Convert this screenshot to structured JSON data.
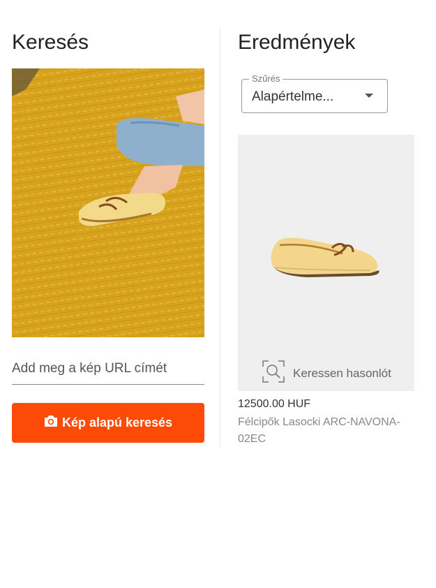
{
  "search": {
    "title": "Keresés",
    "url_placeholder": "Add meg a kép URL címét",
    "button_label": "Kép alapú keresés"
  },
  "results": {
    "title": "Eredmények",
    "filter": {
      "legend": "Szűrés",
      "value": "Alapértelme..."
    },
    "items": [
      {
        "find_similar": "Keressen hasonlót",
        "price": "12500.00 HUF",
        "name": "Félcipők Lasocki ARC-NAVONA-02EC"
      }
    ]
  },
  "colors": {
    "accent": "#fd4a07",
    "card_bg": "#efefef",
    "fabric": "#d9a81f"
  }
}
